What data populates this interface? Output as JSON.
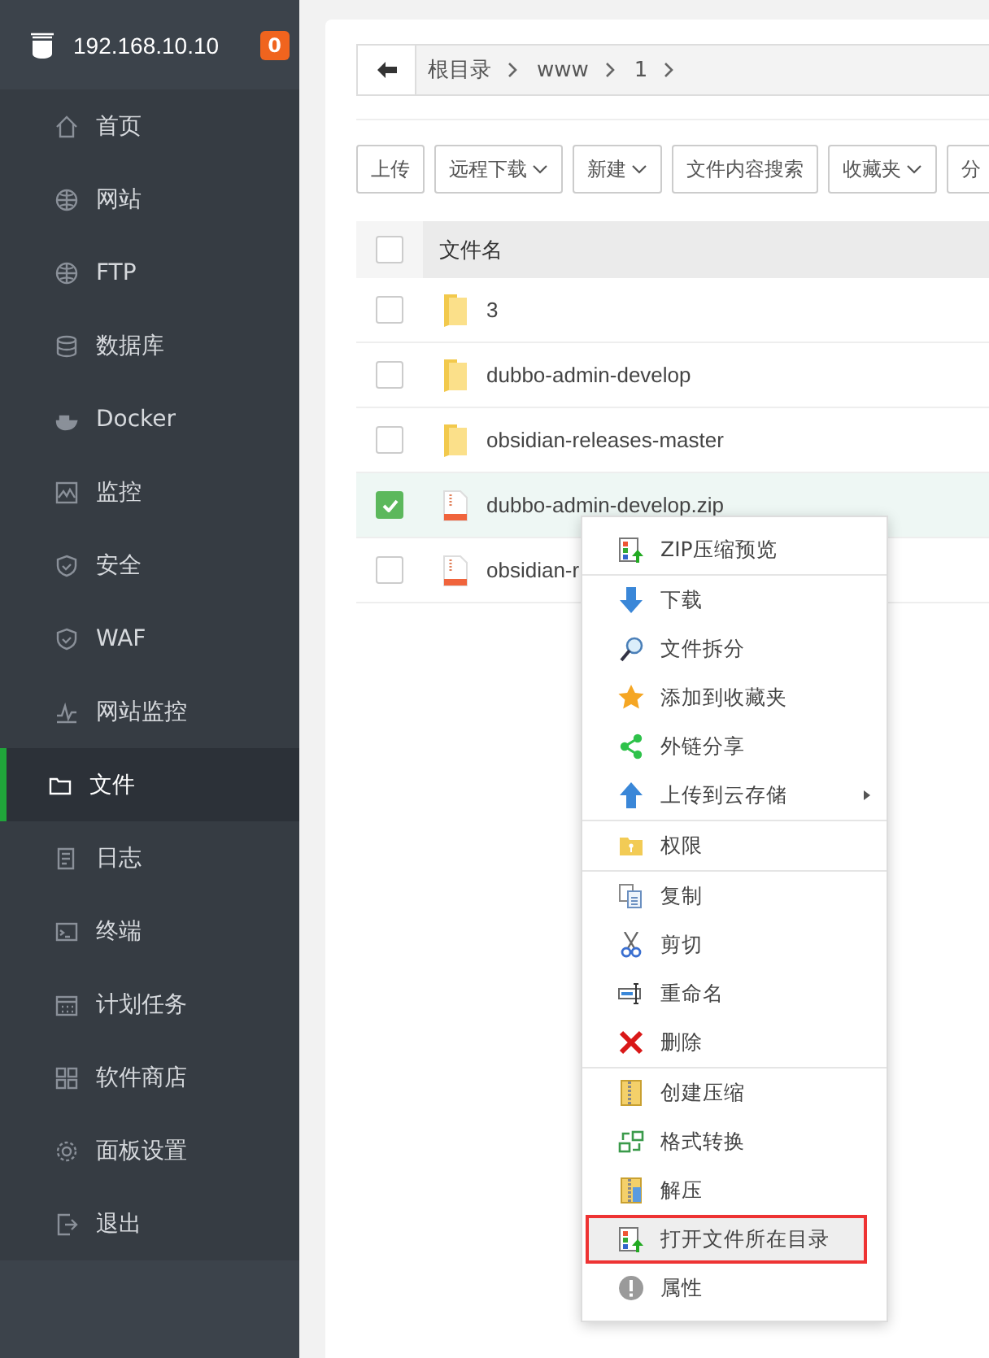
{
  "sidebar": {
    "host": "192.168.10.10",
    "badge": "0",
    "items": [
      {
        "label": "首页",
        "selected": false
      },
      {
        "label": "网站",
        "selected": false
      },
      {
        "label": "FTP",
        "selected": false
      },
      {
        "label": "数据库",
        "selected": false
      },
      {
        "label": "Docker",
        "selected": false
      },
      {
        "label": "监控",
        "selected": false
      },
      {
        "label": "安全",
        "selected": false
      },
      {
        "label": "WAF",
        "selected": false
      },
      {
        "label": "网站监控",
        "selected": false
      },
      {
        "label": "文件",
        "selected": true
      },
      {
        "label": "日志",
        "selected": false
      },
      {
        "label": "终端",
        "selected": false
      },
      {
        "label": "计划任务",
        "selected": false
      },
      {
        "label": "软件商店",
        "selected": false
      },
      {
        "label": "面板设置",
        "selected": false
      },
      {
        "label": "退出",
        "selected": false
      }
    ]
  },
  "breadcrumb": [
    "根目录",
    "www",
    "1"
  ],
  "toolbar": [
    {
      "label": "上传",
      "dropdown": false
    },
    {
      "label": "远程下载",
      "dropdown": true
    },
    {
      "label": "新建",
      "dropdown": true
    },
    {
      "label": "文件内容搜索",
      "dropdown": false
    },
    {
      "label": "收藏夹",
      "dropdown": true
    },
    {
      "label": "分",
      "dropdown": false
    }
  ],
  "table": {
    "columns": [
      "文件名"
    ],
    "header_checked": false,
    "rows": [
      {
        "name": "3",
        "kind": "folder",
        "checked": false
      },
      {
        "name": "dubbo-admin-develop",
        "kind": "folder",
        "checked": false
      },
      {
        "name": "obsidian-releases-master",
        "kind": "folder",
        "checked": false
      },
      {
        "name": "dubbo-admin-develop.zip",
        "kind": "zip",
        "checked": true
      },
      {
        "name": "obsidian-r",
        "kind": "zip",
        "checked": false
      }
    ]
  },
  "context_menu": [
    [
      {
        "label": "ZIP压缩预览",
        "highlighted": false,
        "submenu": false
      }
    ],
    [
      {
        "label": "下载",
        "highlighted": false,
        "submenu": false
      },
      {
        "label": "文件拆分",
        "highlighted": false,
        "submenu": false
      },
      {
        "label": "添加到收藏夹",
        "highlighted": false,
        "submenu": false
      },
      {
        "label": "外链分享",
        "highlighted": false,
        "submenu": false
      },
      {
        "label": "上传到云存储",
        "highlighted": false,
        "submenu": true
      }
    ],
    [
      {
        "label": "权限",
        "highlighted": false,
        "submenu": false
      }
    ],
    [
      {
        "label": "复制",
        "highlighted": false,
        "submenu": false
      },
      {
        "label": "剪切",
        "highlighted": false,
        "submenu": false
      },
      {
        "label": "重命名",
        "highlighted": false,
        "submenu": false
      },
      {
        "label": "删除",
        "highlighted": false,
        "submenu": false
      }
    ],
    [
      {
        "label": "创建压缩",
        "highlighted": false,
        "submenu": false
      },
      {
        "label": "格式转换",
        "highlighted": false,
        "submenu": false
      },
      {
        "label": "解压",
        "highlighted": false,
        "submenu": false
      },
      {
        "label": "打开文件所在目录",
        "highlighted": true,
        "submenu": false
      },
      {
        "label": "属性",
        "highlighted": false,
        "submenu": false
      }
    ]
  ]
}
